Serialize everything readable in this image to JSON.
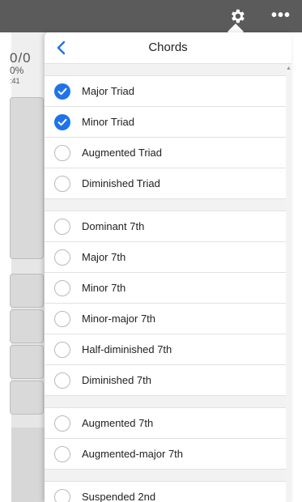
{
  "colors": {
    "topbar": "#5b5b5b",
    "accent": "#1f73e8",
    "separator": "#e2e2e2"
  },
  "topbar": {
    "settings_icon": "gear-icon",
    "more_label": "•••"
  },
  "background_panel": {
    "score": "0/0",
    "percent": "0%",
    "time": ":41"
  },
  "popover": {
    "back_icon": "chevron-left-icon",
    "title": "Chords",
    "sections": [
      {
        "items": [
          {
            "label": "Major Triad",
            "checked": true
          },
          {
            "label": "Minor Triad",
            "checked": true
          },
          {
            "label": "Augmented Triad",
            "checked": false
          },
          {
            "label": "Diminished Triad",
            "checked": false
          }
        ]
      },
      {
        "items": [
          {
            "label": "Dominant 7th",
            "checked": false
          },
          {
            "label": "Major 7th",
            "checked": false
          },
          {
            "label": "Minor 7th",
            "checked": false
          },
          {
            "label": "Minor-major 7th",
            "checked": false
          },
          {
            "label": "Half-diminished 7th",
            "checked": false
          },
          {
            "label": "Diminished 7th",
            "checked": false
          }
        ]
      },
      {
        "items": [
          {
            "label": "Augmented 7th",
            "checked": false
          },
          {
            "label": "Augmented-major 7th",
            "checked": false
          }
        ]
      },
      {
        "items": [
          {
            "label": "Suspended 2nd",
            "checked": false
          }
        ]
      }
    ]
  }
}
